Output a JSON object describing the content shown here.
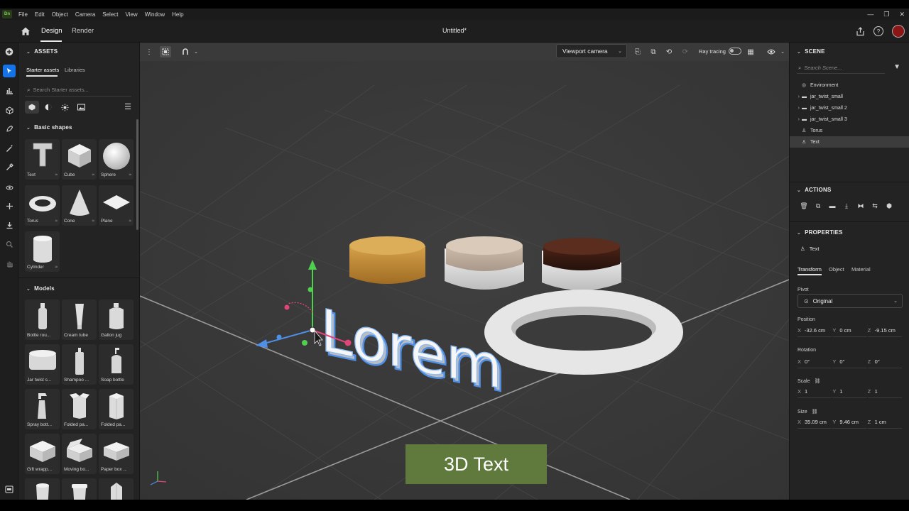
{
  "menubar": {
    "logo": "Dn",
    "items": [
      "File",
      "Edit",
      "Object",
      "Camera",
      "Select",
      "View",
      "Window",
      "Help"
    ],
    "window_controls": [
      "—",
      "❐",
      "✕"
    ]
  },
  "appbar": {
    "tabs": [
      {
        "label": "Design",
        "active": true
      },
      {
        "label": "Render",
        "active": false
      }
    ],
    "doc_title": "Untitled*"
  },
  "toolbar": {
    "tools": [
      "add-icon",
      "select-icon",
      "chart-icon",
      "cube-icon",
      "brush-icon",
      "magic-wand-icon",
      "eyedropper-icon",
      "orbit-icon",
      "move-icon",
      "download-icon",
      "search-icon",
      "hand-icon"
    ],
    "bottom": "layers-icon"
  },
  "assets": {
    "title": "ASSETS",
    "subtabs": [
      "Starter assets",
      "Libraries"
    ],
    "search_placeholder": "Search Starter assets...",
    "basic_title": "Basic shapes",
    "basic_shapes": [
      {
        "label": "Text",
        "opt": "≈"
      },
      {
        "label": "Cube",
        "opt": "≈"
      },
      {
        "label": "Sphere",
        "opt": "≈"
      },
      {
        "label": "Torus",
        "opt": "≈"
      },
      {
        "label": "Cone",
        "opt": "≈"
      },
      {
        "label": "Plane",
        "opt": "≈"
      },
      {
        "label": "Cylinder",
        "opt": "≈"
      }
    ],
    "models_title": "Models",
    "models": [
      {
        "label": "Bottle rou..."
      },
      {
        "label": "Cream tube"
      },
      {
        "label": "Gallon jug"
      },
      {
        "label": "Jar twist s..."
      },
      {
        "label": "Shampoo ..."
      },
      {
        "label": "Soap bottle"
      },
      {
        "label": "Spray bott..."
      },
      {
        "label": "Folded pa..."
      },
      {
        "label": "Folded pa..."
      },
      {
        "label": "Gift wrapp..."
      },
      {
        "label": "Moving bo..."
      },
      {
        "label": "Paper box ..."
      }
    ]
  },
  "viewport": {
    "camera_label": "Viewport camera",
    "ray_tracing_label": "Ray tracing",
    "ray_tracing_on": false,
    "scene_text": "Lorem",
    "caption": "3D Text",
    "colors": {
      "bg": "#3a3a3a",
      "grid": "#4a4a4a",
      "selection": "#4f8fe6",
      "caption_bg": "#5f7a3c"
    }
  },
  "scene": {
    "title": "SCENE",
    "search_placeholder": "Search Scene...",
    "items": [
      {
        "label": "Environment",
        "expandable": false,
        "icon": "globe-icon",
        "selected": false
      },
      {
        "label": "jar_twist_small",
        "expandable": true,
        "icon": "folder-icon",
        "selected": false
      },
      {
        "label": "jar_twist_small 2",
        "expandable": true,
        "icon": "folder-icon",
        "selected": false
      },
      {
        "label": "jar_twist_small 3",
        "expandable": true,
        "icon": "folder-icon",
        "selected": false
      },
      {
        "label": "Torus",
        "expandable": false,
        "icon": "shape-icon",
        "selected": false
      },
      {
        "label": "Text",
        "expandable": false,
        "icon": "text-icon",
        "selected": true
      }
    ]
  },
  "actions": {
    "title": "ACTIONS",
    "icons": [
      "delete-icon",
      "duplicate-icon",
      "group-icon",
      "export-icon",
      "mirror-icon",
      "swap-icon",
      "material-icon"
    ]
  },
  "properties": {
    "title": "PROPERTIES",
    "object_name": "Text",
    "tabs": [
      "Transform",
      "Object",
      "Material"
    ],
    "pivot_label": "Pivot",
    "pivot_value": "Original",
    "position_label": "Position",
    "position": {
      "x": "-32.6 cm",
      "y": "0 cm",
      "z": "-9.15 cm"
    },
    "rotation_label": "Rotation",
    "rotation": {
      "x": "0°",
      "y": "0°",
      "z": "0°"
    },
    "scale_label": "Scale",
    "scale": {
      "x": "1",
      "y": "1",
      "z": "1"
    },
    "size_label": "Size",
    "size": {
      "x": "35.09 cm",
      "y": "9.46 cm",
      "z": "1 cm"
    }
  }
}
